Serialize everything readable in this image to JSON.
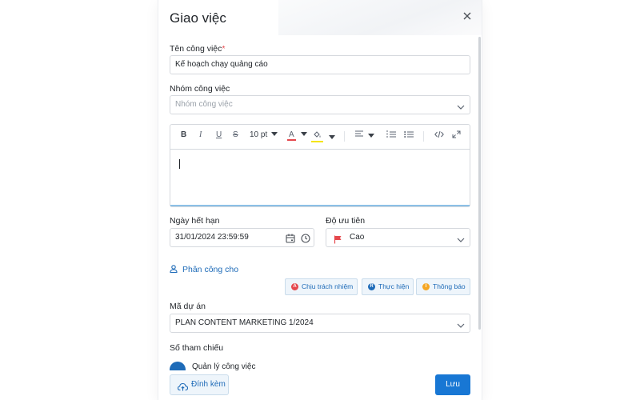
{
  "dialog": {
    "title": "Giao việc"
  },
  "form": {
    "task_name": {
      "label": "Tên công việc",
      "required_mark": "*",
      "value": "Kế hoạch chạy quảng cáo"
    },
    "task_group": {
      "label": "Nhóm công việc",
      "placeholder": "Nhóm công việc"
    },
    "editor": {
      "toolbar": {
        "bold": "B",
        "italic": "I",
        "underline": "U",
        "strike": "S",
        "font_size": "10 pt",
        "text_color_letter": "A"
      },
      "colors": {
        "text_color": "#e5484d",
        "highlight_color": "#f5e400"
      }
    },
    "due_date": {
      "label": "Ngày hết hạn",
      "value": "31/01/2024 23:59:59"
    },
    "priority": {
      "label": "Độ ưu tiên",
      "value": "Cao",
      "flag_color": "#e5484d"
    },
    "assign": {
      "label": "Phân công cho",
      "roles": [
        {
          "letter": "A",
          "label": "Chịu trách nhiệm",
          "color": "#e5484d"
        },
        {
          "letter": "R",
          "label": "Thực hiện",
          "color": "#1e6bb8"
        },
        {
          "letter": "I",
          "label": "Thông báo",
          "color": "#f5a623"
        }
      ]
    },
    "project_code": {
      "label": "Mã dự án",
      "value": "PLAN CONTENT MARKETING 1/2024"
    },
    "reference": {
      "label": "Số tham chiếu",
      "item": "Quản lý công việc"
    }
  },
  "footer": {
    "attach_label": "Đính kèm",
    "save_label": "Lưu"
  },
  "colors": {
    "accent": "#1e6bb8",
    "primary_button": "#1877d4"
  }
}
